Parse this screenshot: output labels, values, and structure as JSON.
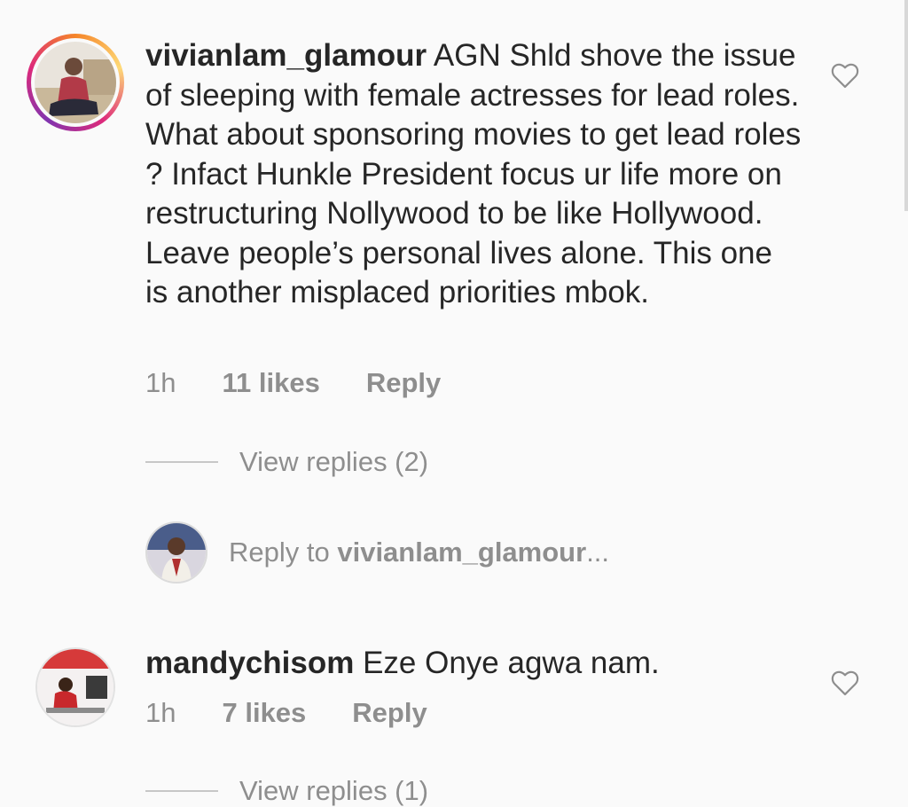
{
  "comments": [
    {
      "username": "vivianlam_glamour",
      "text": " AGN Shld shove the issue of sleeping with female actresses for lead roles. What about sponsoring movies to get lead roles ? Infact Hunkle President focus ur life more on restructuring Nollywood to be like Hollywood. Leave people’s personal lives alone. This one is another misplaced priorities mbok.",
      "time": "1h",
      "likes": "11 likes",
      "reply_label": "Reply",
      "view_replies": "View replies (2)"
    },
    {
      "username": "mandychisom",
      "text": " Eze Onye agwa nam.",
      "time": "1h",
      "likes": "7 likes",
      "reply_label": "Reply",
      "view_replies": "View replies (1)"
    }
  ],
  "reply_box": {
    "prefix": "Reply to ",
    "target": "vivianlam_glamour",
    "suffix": "..."
  },
  "icons": {
    "heart": "heart-outline-icon"
  },
  "colors": {
    "text": "#262626",
    "secondary": "#8e8e8e",
    "background": "#fafafa"
  }
}
